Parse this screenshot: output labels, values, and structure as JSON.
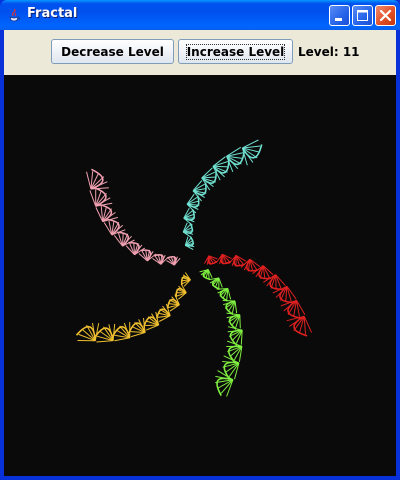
{
  "window": {
    "title": "Fractal"
  },
  "toolbar": {
    "decrease_label": "Decrease Level",
    "increase_label": "Increase Level",
    "level_text": "Level: 11"
  },
  "fractal": {
    "level": 11,
    "background_color": "#0a0a0a",
    "arm_colors": [
      "#e02020",
      "#70e0d0",
      "#f0a0b0",
      "#f0c030",
      "#80f040"
    ]
  },
  "colors": {
    "titlebar": "#0054e3",
    "toolbar_bg": "#ece9d8",
    "close_button": "#e04d25"
  }
}
